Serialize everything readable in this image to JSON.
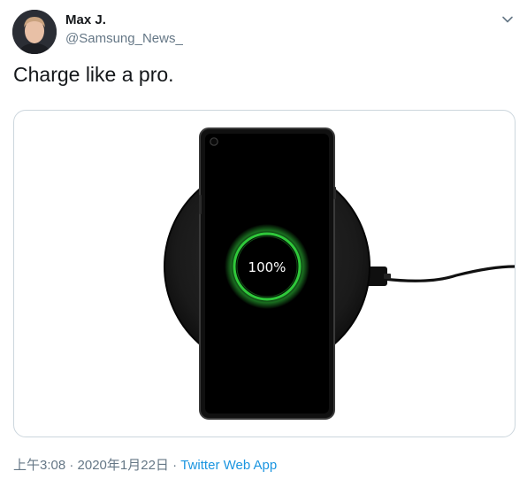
{
  "author": {
    "name": "Max J.",
    "handle": "@Samsung_News_"
  },
  "tweet": {
    "text": "Charge like a pro."
  },
  "media": {
    "charge_level": "100%",
    "ring_color": "#2fc83a"
  },
  "meta": {
    "timestamp": "上午3:08 · 2020年1月22日",
    "separator": " · ",
    "source": "Twitter Web App"
  },
  "icons": {
    "menu": "chevron-down-icon"
  },
  "colors": {
    "link": "#1b95e0",
    "secondary_text": "#657786",
    "primary_text": "#14171a",
    "border": "#ccd6dd"
  }
}
